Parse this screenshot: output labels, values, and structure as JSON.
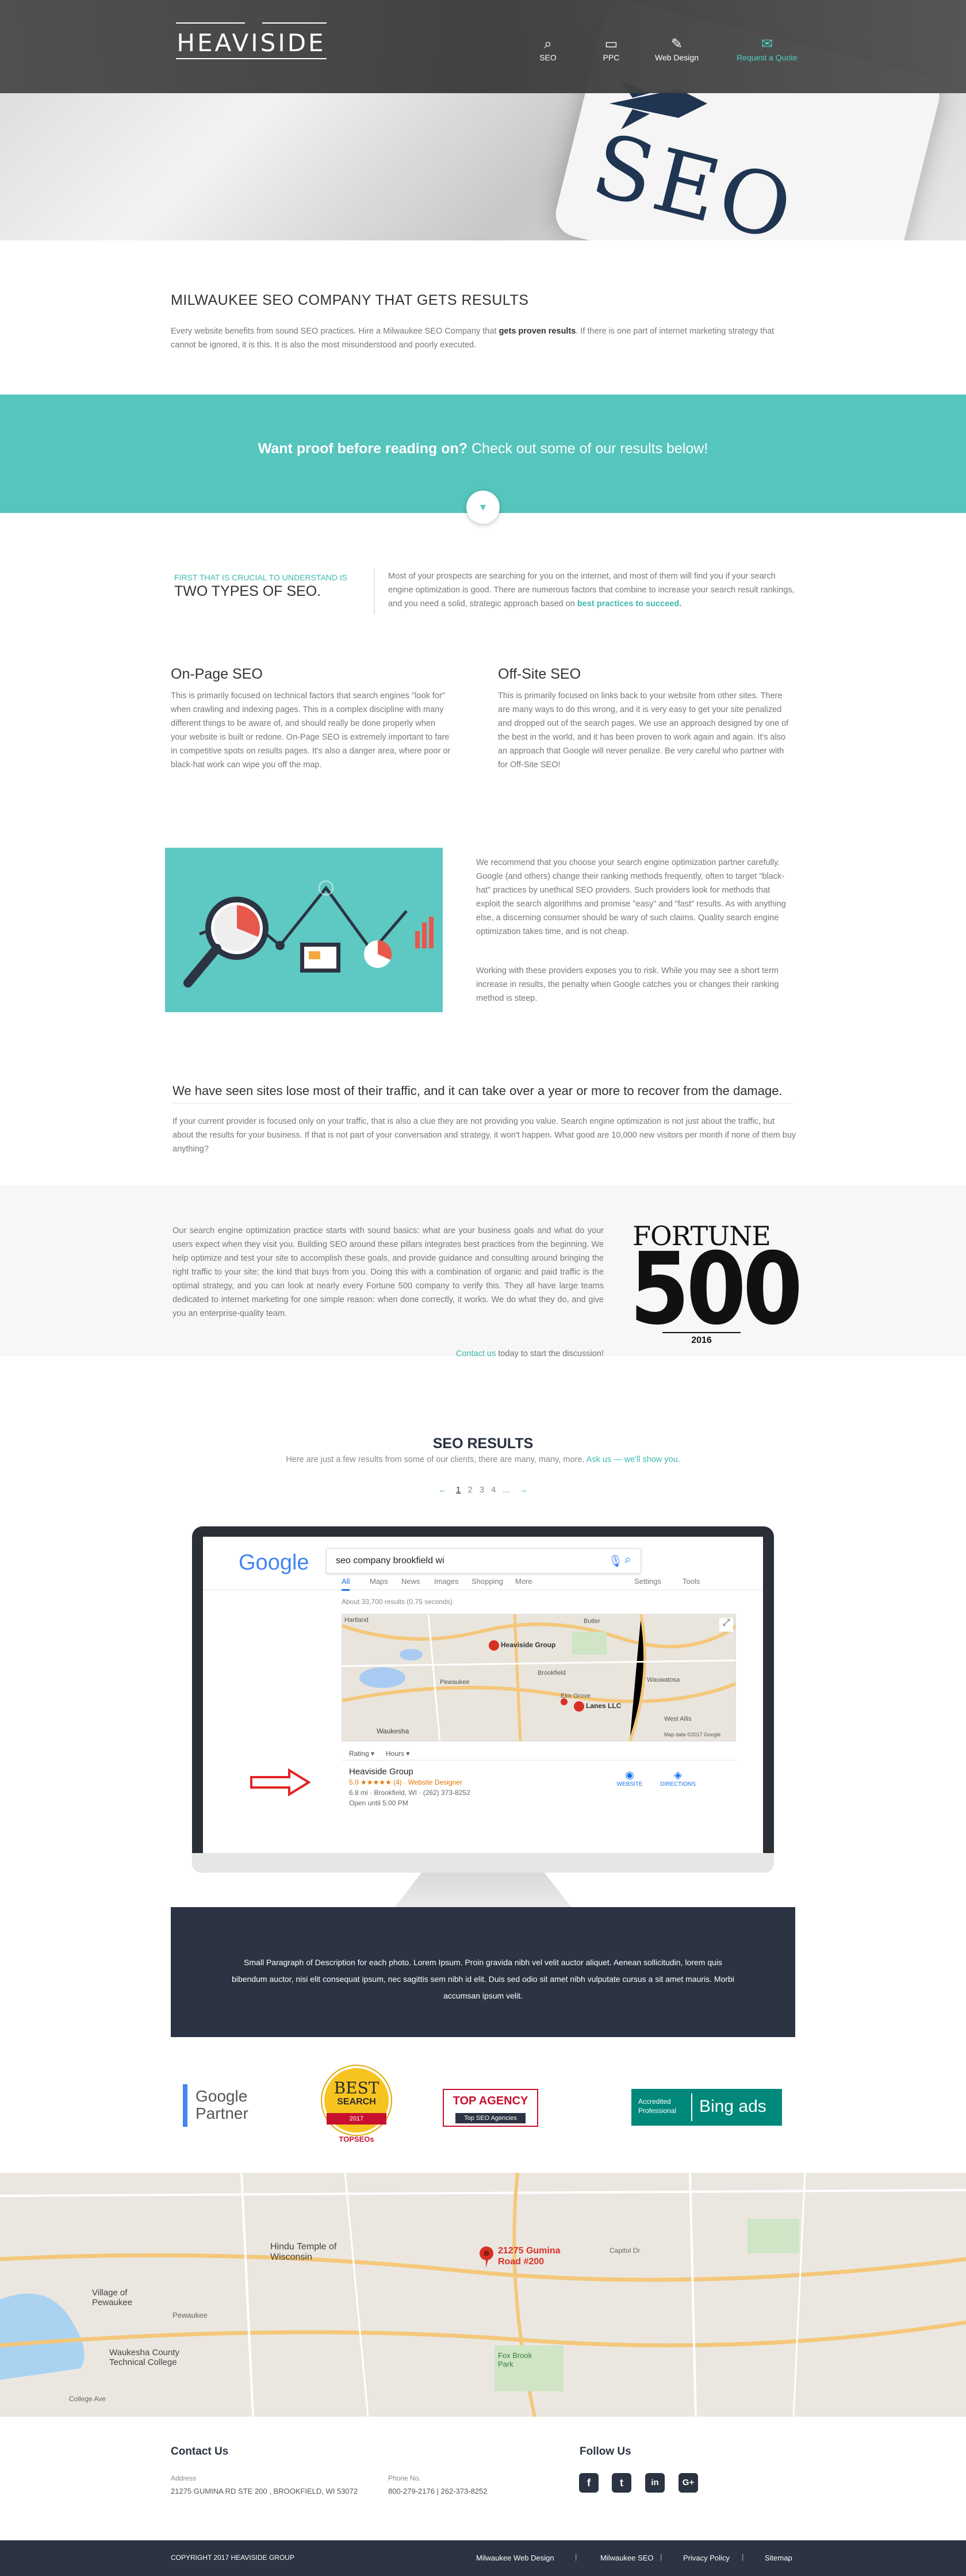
{
  "header": {
    "logo_text": "HEAVISIDE",
    "nav": [
      {
        "label": "SEO",
        "icon": "search-icon"
      },
      {
        "label": "PPC",
        "icon": "monitor-icon"
      },
      {
        "label": "Web Design",
        "icon": "design-icon"
      },
      {
        "label": "Request a Quote",
        "icon": "quote-icon"
      }
    ],
    "hero_text": "SEO"
  },
  "intro": {
    "title": "MILWAUKEE SEO COMPANY THAT GETS RESULTS",
    "text_a": "Every website benefits from sound SEO practices. Hire a Milwaukee SEO Company that ",
    "text_bold": "gets proven results",
    "text_b": ". If there is one part of internet marketing strategy that cannot be ignored, it is this. It is also the most misunderstood and poorly executed."
  },
  "band": {
    "bold": "Want proof before reading on?",
    "rest": " Check out some of our results below!",
    "arrow": "▾"
  },
  "types": {
    "kicker": "FIRST THAT IS CRUCIAL TO UNDERSTAND IS",
    "heading": "TWO TYPES OF SEO.",
    "text": "Most of your prospects are searching for you on the internet, and most of them will find you if your search engine optimization is good. There are numerous factors that combine to increase your search result rankings, and you need a solid, strategic approach based on ",
    "link": "best practices to succeed."
  },
  "onpage": {
    "title": "On-Page SEO",
    "text": "This is primarily focused on technical factors that search engines \"look for\" when crawling and indexing pages. This is a complex discipline with many different things to be aware of, and should really be done properly when your website is built or redone. On-Page SEO is extremely important to fare in competitive spots on results pages. It's also a danger area, where poor or black-hat work can wipe you off the map."
  },
  "offsite": {
    "title": "Off-Site SEO",
    "text": "This is primarily focused on links back to your website from other sites. There are many ways to do this wrong, and it is very easy to get your site penalized and dropped out of the search pages. We use an approach designed by one of the best in the world, and it has been proven to work again and again. It's also an approach that Google will never penalize. Be very careful who partner with for Off-Site SEO!"
  },
  "recommend": {
    "p1": "We recommend that you choose your search engine optimization partner carefully. Google (and others) change their ranking methods frequently, often to target \"black-hat\" practices by unethical SEO providers. Such providers look for methods that exploit the search algorithms and promise \"easy\" and \"fast\" results. As with anything else, a discerning consumer should be wary of such claims. Quality search engine optimization takes time, and is not cheap.",
    "p2": "Working with these providers exposes you to risk. While you may see a short term increase in results, the penalty when Google catches you or changes their ranking method is steep."
  },
  "traffic": {
    "heading": "We have seen sites lose most of their traffic, and it can take over a year or more to recover from the damage.",
    "text": "If your current provider is focused only on your traffic, that is also a clue they are not providing you value. Search engine optimization is not just about the traffic, but about the results for your business. If that is not part of your conversation and strategy, it won't happen. What good are 10,000 new visitors per month if none of them buy anything?"
  },
  "fortune": {
    "text": "Our search engine optimization practice starts with sound basics: what are your business goals and what do your users expect when they visit you. Building SEO around these pillars integrates best practices from the beginning. We help optimize and test your site to accomplish these goals, and provide guidance and consulting around bringing the right traffic to your site; the kind that buys from you. Doing this with a combination of organic and paid traffic is the optimal strategy, and you can look at nearly every Fortune 500 company to verify this. They all have large teams dedicated to internet marketing for one simple reason: when done correctly, it works. We do what they do, and give you an enterprise-quality team.",
    "contact_link": "Contact us",
    "contact_rest": " today to start the discussion!",
    "logo_word": "FORTUNE",
    "logo_num": "500",
    "logo_year": "2016"
  },
  "results": {
    "title": "SEO RESULTS",
    "sub": "Here are just a few results from some of our clients, there are many, many, more. ",
    "sub_link": "Ask us — we'll show you.",
    "prev": "←",
    "pages": [
      "1",
      "2",
      "3",
      "4",
      "..."
    ],
    "next": "→"
  },
  "google": {
    "logo": "Google",
    "query": "seo company brookfield wi",
    "tabs": [
      "All",
      "Maps",
      "News",
      "Images",
      "Shopping",
      "More"
    ],
    "tools": [
      "Settings",
      "Tools"
    ],
    "stats": "About 33,700 results (0.75 seconds)",
    "map_labels": [
      "Heaviside Group",
      "Lanes LLC",
      "Brookfield",
      "Pewaukee",
      "Wauwatosa",
      "Butler",
      "Elm Grove",
      "West Allis",
      "Waukesha",
      "Hartland"
    ],
    "map_data": "Map data ©2017 Google",
    "filters": [
      "Rating ▾",
      "Hours ▾"
    ],
    "listing_name": "Heaviside Group",
    "listing_rating": "5.0 ★★★★★ (4) · Website Designer",
    "listing_addr": "6.8 mi · Brookfield, WI · (262) 373-8252",
    "listing_open": "Open until 5:00 PM",
    "btn_website": "WEBSITE",
    "btn_directions": "DIRECTIONS"
  },
  "caption": "Small Paragraph of Description for each photo. Lorem Ipsum. Proin gravida nibh vel velit auctor aliquet. Aenean sollicitudin, lorem quis bibendum auctor, nisi elit consequat ipsum, nec sagittis sem nibh id elit. Duis sed odio sit amet nibh vulputate cursus a sit amet mauris. Morbi accumsan ipsum velit.",
  "badges": {
    "google": "Google Partner",
    "best_a": "BEST",
    "best_b": "SEARCH",
    "best_year": "2017",
    "topseos": "TOPSEOs",
    "top_agency": "TOP AGENCY",
    "top_agency_sub": "Top SEO Agencies",
    "bing_a": "Accredited Professional",
    "bing_b": "Bing ads"
  },
  "map": {
    "pin": "21275 Gumina Road #200",
    "labels": [
      "Hindu Temple of Wisconsin",
      "Village of Pewaukee",
      "Waukesha County Technical College",
      "Fox Brook Park",
      "Capitol Dr",
      "College Ave",
      "Pewaukee"
    ]
  },
  "footer": {
    "contact_title": "Contact Us",
    "address_label": "Address",
    "address": "21275 GUMINA RD STE 200 , BROOKFIELD, WI 53072",
    "phone_label": "Phone No.",
    "phone": "800-279-2176 | 262-373-8252",
    "follow_title": "Follow Us",
    "social": [
      "f",
      "t",
      "in",
      "G+"
    ],
    "copyright": "COPYRIGHT 2017 HEAVISIDE GROUP",
    "links": [
      "Milwaukee Web Design",
      "Milwaukee SEO",
      "Privacy Policy",
      "Sitemap"
    ]
  }
}
